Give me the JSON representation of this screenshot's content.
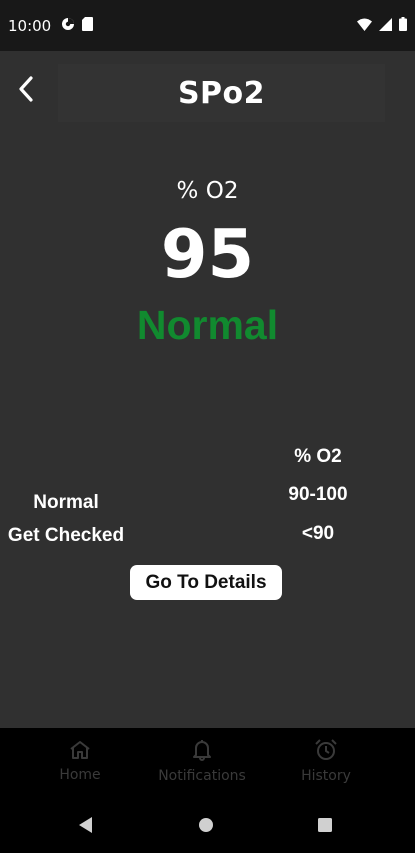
{
  "status_bar": {
    "time": "10:00"
  },
  "header": {
    "title": "SPo2"
  },
  "reading": {
    "unit": "% O2",
    "value": "95",
    "status": "Normal",
    "status_color": "#118a2f"
  },
  "ranges": {
    "column_header": "% O2",
    "rows": [
      {
        "label": "Normal",
        "range": "90-100"
      },
      {
        "label": "Get Checked",
        "range": "<90"
      }
    ]
  },
  "details_button": {
    "label": "Go To Details"
  },
  "bottom_nav": {
    "items": [
      {
        "label": "Home",
        "icon": "home-icon"
      },
      {
        "label": "Notifications",
        "icon": "bell-icon"
      },
      {
        "label": "History",
        "icon": "alarm-clock-icon"
      }
    ]
  },
  "system_nav": {
    "icons": [
      "back-triangle-icon",
      "home-circle-icon",
      "recents-square-icon"
    ]
  }
}
